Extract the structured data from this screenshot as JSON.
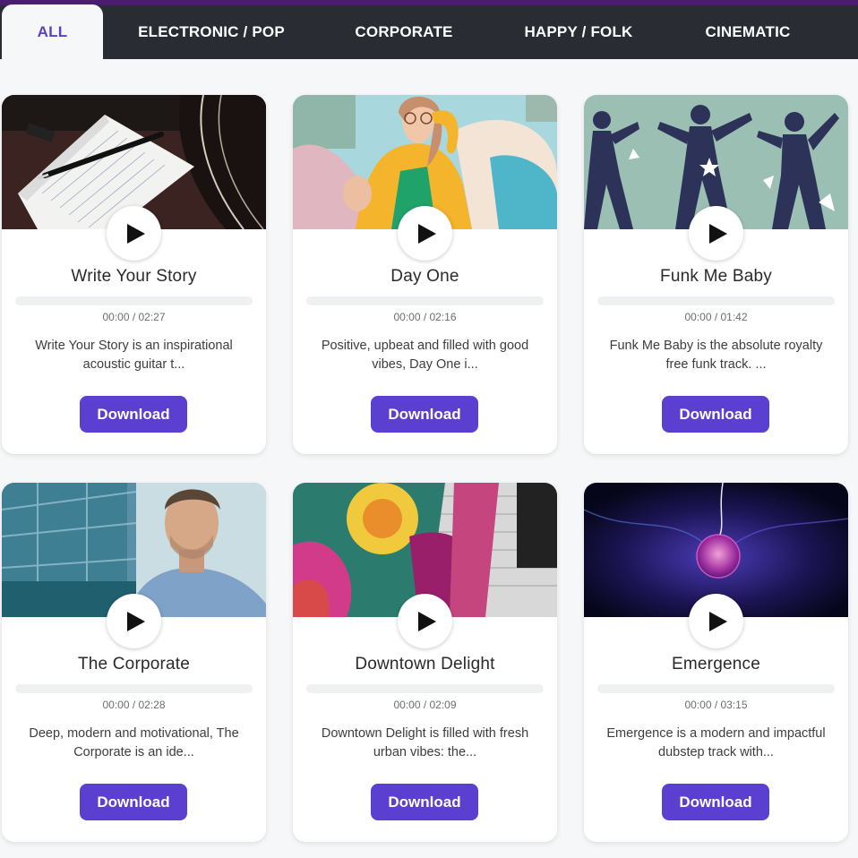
{
  "tabs": [
    {
      "label": "ALL",
      "active": true
    },
    {
      "label": "ELECTRONIC / POP",
      "active": false
    },
    {
      "label": "CORPORATE",
      "active": false
    },
    {
      "label": "HAPPY / FOLK",
      "active": false
    },
    {
      "label": "CINEMATIC",
      "active": false
    }
  ],
  "colors": {
    "accent": "#5b3fd0",
    "tab_bar": "#2a2c33",
    "active_tab_text": "#5a3fc8",
    "page_bg": "#f6f7f9"
  },
  "tracks": [
    {
      "title": "Write Your Story",
      "time": "00:00 / 02:27",
      "description": "Write Your Story is an inspirational acoustic guitar t...",
      "download_label": "Download",
      "image": "notebook-and-guitar",
      "progress": 0
    },
    {
      "title": "Day One",
      "time": "00:00 / 02:16",
      "description": "Positive, upbeat and filled with good vibes, Day One i...",
      "download_label": "Download",
      "image": "woman-in-yellow-jacket",
      "progress": 0
    },
    {
      "title": "Funk Me Baby",
      "time": "00:00 / 01:42",
      "description": "Funk Me Baby is the absolute royalty free funk track. ...",
      "download_label": "Download",
      "image": "dancing-silhouettes",
      "progress": 0
    },
    {
      "title": "The Corporate",
      "time": "00:00 / 02:28",
      "description": "Deep, modern and motivational, The Corporate is an ide...",
      "download_label": "Download",
      "image": "businessman-glass-building",
      "progress": 0
    },
    {
      "title": "Downtown Delight",
      "time": "00:00 / 02:09",
      "description": "Downtown Delight is filled with fresh urban vibes: the...",
      "download_label": "Download",
      "image": "graffiti-wall",
      "progress": 0
    },
    {
      "title": "Emergence",
      "time": "00:00 / 03:15",
      "description": "Emergence is a modern and impactful dubstep track with...",
      "download_label": "Download",
      "image": "plasma-ball",
      "progress": 0
    }
  ]
}
